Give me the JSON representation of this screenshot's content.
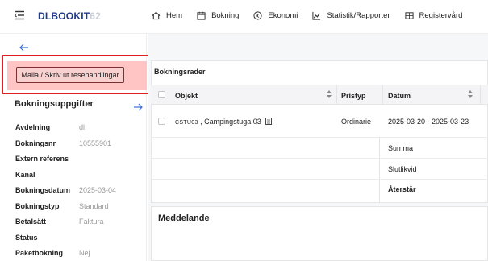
{
  "app": {
    "logo_brand": "DLBOOKIT",
    "logo_version": "62"
  },
  "nav": [
    {
      "label": "Hem",
      "icon": "home-icon"
    },
    {
      "label": "Bokning",
      "icon": "calendar-icon"
    },
    {
      "label": "Ekonomi",
      "icon": "currency-icon"
    },
    {
      "label": "Statistik/Rapporter",
      "icon": "chart-icon"
    },
    {
      "label": "Registervård",
      "icon": "grid-icon"
    }
  ],
  "sidebar": {
    "mail_button": "Maila / Skriv ut resehandlingar",
    "section_title": "Bokningsuppgifter",
    "details": [
      {
        "key": "Avdelning",
        "value": "dl"
      },
      {
        "key": "Bokningsnr",
        "value": "10555901"
      },
      {
        "key": "Extern referens",
        "value": ""
      },
      {
        "key": "Kanal",
        "value": ""
      },
      {
        "key": "Bokningsdatum",
        "value": "2025-03-04"
      },
      {
        "key": "Bokningstyp",
        "value": "Standard"
      },
      {
        "key": "Betalsätt",
        "value": "Faktura"
      },
      {
        "key": "Status",
        "value": ""
      },
      {
        "key": "Paketbokning",
        "value": "Nej"
      }
    ]
  },
  "bookings": {
    "title": "Bokningsrader",
    "columns": {
      "objekt": "Objekt",
      "pristyp": "Pristyp",
      "datum": "Datum"
    },
    "row": {
      "code": "CSTU03",
      "name": ", Campingstuga 03",
      "pristyp": "Ordinarie",
      "datum": "2025-03-20 - 2025-03-23"
    },
    "summary": {
      "summa": "Summa",
      "slutlikvid": "Slutlikvid",
      "aterstar": "Återstår"
    }
  },
  "message": {
    "title": "Meddelande"
  },
  "colors": {
    "brand": "#1e3a8a",
    "highlight": "#e02020",
    "pink": "#ffc4c4",
    "accent": "#3b6fd8"
  }
}
